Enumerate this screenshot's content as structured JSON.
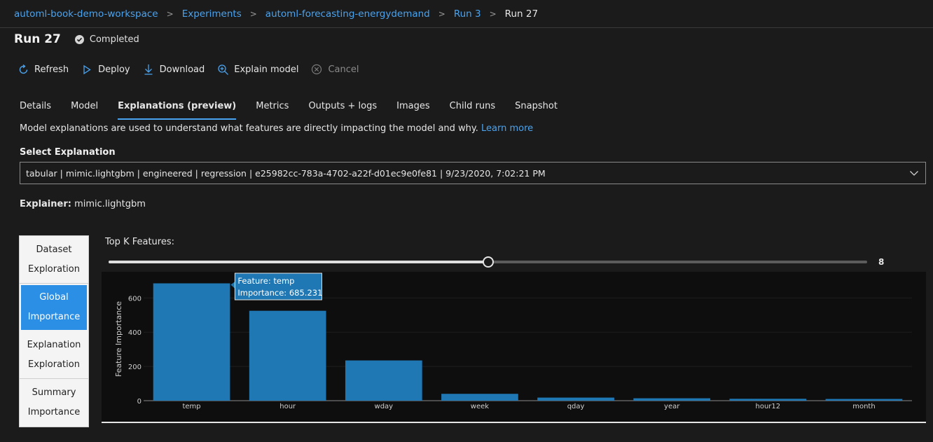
{
  "breadcrumb": {
    "items": [
      "automl-book-demo-workspace",
      "Experiments",
      "automl-forecasting-energydemand",
      "Run 3",
      "Run 27"
    ]
  },
  "header": {
    "title": "Run 27",
    "status": "Completed"
  },
  "toolbar": {
    "refresh": "Refresh",
    "deploy": "Deploy",
    "download": "Download",
    "explain": "Explain model",
    "cancel": "Cancel"
  },
  "tabs": [
    "Details",
    "Model",
    "Explanations (preview)",
    "Metrics",
    "Outputs + logs",
    "Images",
    "Child runs",
    "Snapshot"
  ],
  "description": {
    "text": "Model explanations are used to understand what features are directly impacting the model and why. ",
    "link": "Learn more"
  },
  "select": {
    "label": "Select Explanation",
    "value": "tabular | mimic.lightgbm | engineered | regression | e25982cc-783a-4702-a22f-d01ec9e0fe81 | 9/23/2020, 7:02:21 PM"
  },
  "explainer": {
    "label": "Explainer:",
    "value": "mimic.lightgbm"
  },
  "side_nav": {
    "items": [
      {
        "line1": "Dataset",
        "line2": "Exploration"
      },
      {
        "line1": "Global",
        "line2": "Importance"
      },
      {
        "line1": "Explanation",
        "line2": "Exploration"
      },
      {
        "line1": "Summary",
        "line2": "Importance"
      }
    ],
    "active_index": 1
  },
  "topk": {
    "label": "Top K Features:",
    "value": "8",
    "fraction": 0.5
  },
  "colors": {
    "accent": "#4aa3ef",
    "bar": "#1f77b4",
    "nav_active": "#2b8fe6"
  },
  "chart_data": {
    "type": "bar",
    "categories": [
      "temp",
      "hour",
      "wday",
      "week",
      "qday",
      "year",
      "hour12",
      "month"
    ],
    "values": [
      685.231,
      525,
      235,
      40,
      18,
      14,
      11,
      10
    ],
    "ylabel": "Feature Importance",
    "ylim": [
      0,
      720
    ],
    "yticks": [
      0,
      200,
      400,
      600
    ],
    "tooltip": {
      "line1": "Feature: temp",
      "line2": "Importance: 685.231"
    },
    "grid": true
  }
}
